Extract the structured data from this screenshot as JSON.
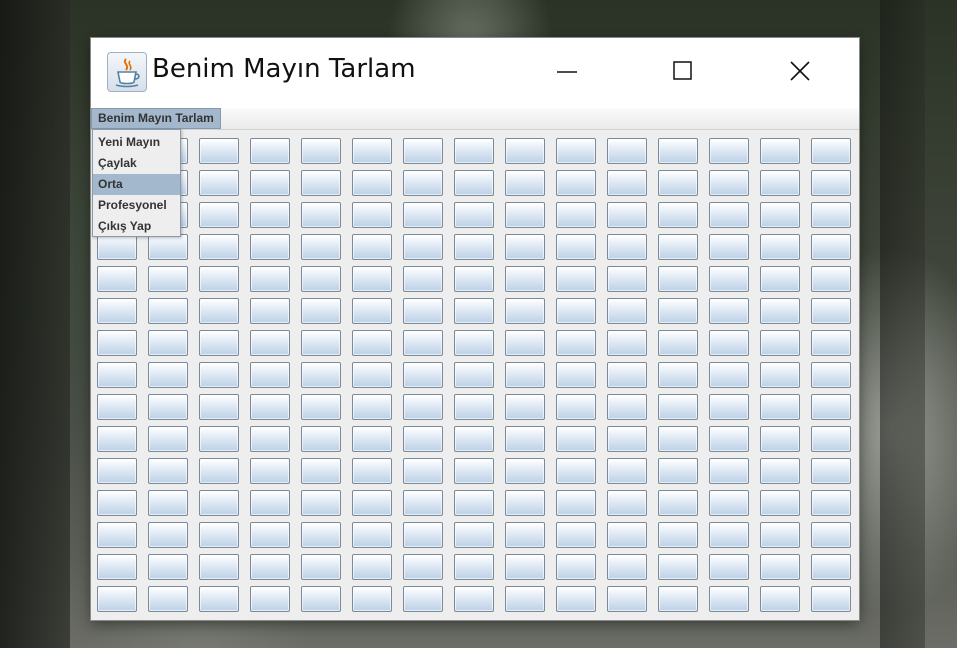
{
  "window": {
    "title": "Benim Mayın Tarlam",
    "icon": "java-cup-icon",
    "controls": {
      "minimize": "minimize-icon",
      "maximize": "maximize-icon",
      "close": "close-icon"
    }
  },
  "menubar": {
    "menu_label": "Benim Mayın Tarlam"
  },
  "dropdown": {
    "items": [
      {
        "label": "Yeni Mayın"
      },
      {
        "label": "Çaylak"
      },
      {
        "label": "Orta",
        "selected": true
      },
      {
        "label": "Profesyonel"
      },
      {
        "label": "Çıkış Yap"
      }
    ]
  },
  "board": {
    "rows": 15,
    "columns": 15,
    "cell_state": "covered"
  },
  "colors": {
    "menu_highlight": "#a3b8cc",
    "window_background": "#eeeeee",
    "cell_gradient_top": "#ffffff",
    "cell_gradient_bottom": "#bcd0e5",
    "cell_border": "#7a8a99"
  }
}
